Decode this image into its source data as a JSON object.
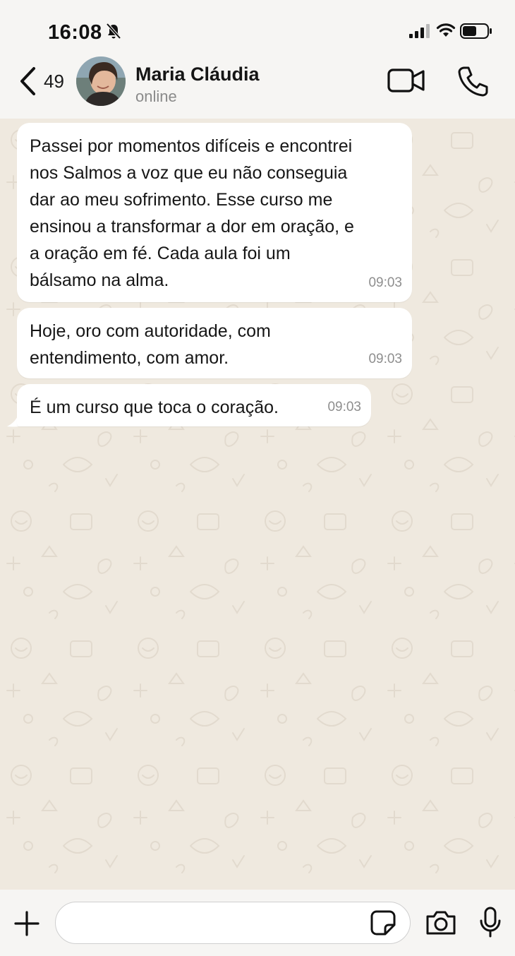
{
  "status_bar": {
    "time": "16:08",
    "icons": [
      "bell-muted-icon",
      "cellular-signal-icon",
      "wifi-icon",
      "battery-icon"
    ]
  },
  "header": {
    "back_count": "49",
    "contact_name": "Maria Cláudia",
    "contact_status": "online",
    "icons": [
      "chevron-left-icon",
      "video-camera-icon",
      "phone-icon"
    ]
  },
  "messages": [
    {
      "text": "Passei por momentos difíceis e encontrei\nnos Salmos a voz que eu não conseguia\ndar ao meu sofrimento. Esse curso me\nensinou a transformar a dor em oração, e\na oração em fé. Cada aula foi um\nbálsamo na alma.",
      "time": "09:03"
    },
    {
      "text": "Hoje, oro com autoridade, com\nentendimento, com amor.",
      "time": "09:03"
    },
    {
      "text": "É um curso que toca o coração.",
      "time": "09:03"
    }
  ],
  "composer": {
    "input_value": "",
    "icons": [
      "plus-icon",
      "sticker-icon",
      "camera-icon",
      "microphone-icon"
    ]
  },
  "colors": {
    "wallpaper": "#efe9df",
    "bubble": "#ffffff",
    "bar_background": "#f6f5f3",
    "timestamp": "#8e8e8e",
    "secondary_text": "#8a8a8a"
  }
}
